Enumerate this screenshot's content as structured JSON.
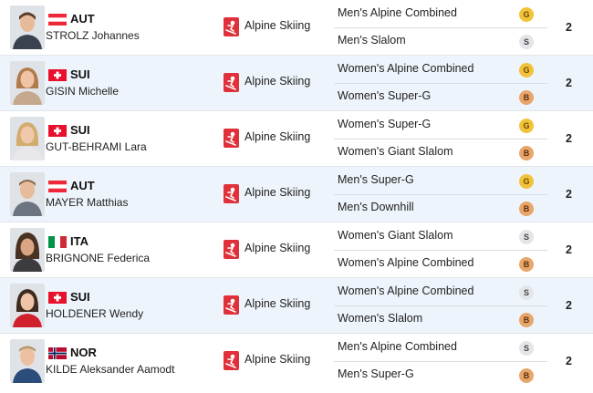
{
  "sport_icon": "alpine-skiing-icon",
  "colors": {
    "row_alt": "#eef4fb",
    "sport_icon_bg": "#e0303a",
    "gold": "#f2c33a",
    "silver": "#e3e5e8",
    "bronze": "#e8a66a"
  },
  "athletes": [
    {
      "country": "AUT",
      "name": "STROLZ Johannes",
      "sport": "Alpine Skiing",
      "events": [
        {
          "name": "Men's Alpine Combined",
          "medal": "G"
        },
        {
          "name": "Men's Slalom",
          "medal": "S"
        }
      ],
      "total": "2"
    },
    {
      "country": "SUI",
      "name": "GISIN Michelle",
      "sport": "Alpine Skiing",
      "events": [
        {
          "name": "Women's Alpine Combined",
          "medal": "G"
        },
        {
          "name": "Women's Super-G",
          "medal": "B"
        }
      ],
      "total": "2"
    },
    {
      "country": "SUI",
      "name": "GUT-BEHRAMI Lara",
      "sport": "Alpine Skiing",
      "events": [
        {
          "name": "Women's Super-G",
          "medal": "G"
        },
        {
          "name": "Women's Giant Slalom",
          "medal": "B"
        }
      ],
      "total": "2"
    },
    {
      "country": "AUT",
      "name": "MAYER Matthias",
      "sport": "Alpine Skiing",
      "events": [
        {
          "name": "Men's Super-G",
          "medal": "G"
        },
        {
          "name": "Men's Downhill",
          "medal": "B"
        }
      ],
      "total": "2"
    },
    {
      "country": "ITA",
      "name": "BRIGNONE Federica",
      "sport": "Alpine Skiing",
      "events": [
        {
          "name": "Women's Giant Slalom",
          "medal": "S"
        },
        {
          "name": "Women's Alpine Combined",
          "medal": "B"
        }
      ],
      "total": "2"
    },
    {
      "country": "SUI",
      "name": "HOLDENER Wendy",
      "sport": "Alpine Skiing",
      "events": [
        {
          "name": "Women's Alpine Combined",
          "medal": "S"
        },
        {
          "name": "Women's Slalom",
          "medal": "B"
        }
      ],
      "total": "2"
    },
    {
      "country": "NOR",
      "name": "KILDE Aleksander Aamodt",
      "sport": "Alpine Skiing",
      "events": [
        {
          "name": "Men's Alpine Combined",
          "medal": "S"
        },
        {
          "name": "Men's Super-G",
          "medal": "B"
        }
      ],
      "total": "2"
    }
  ]
}
